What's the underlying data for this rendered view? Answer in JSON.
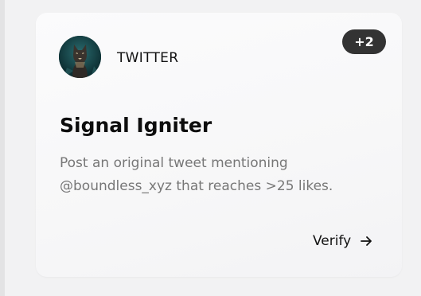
{
  "card": {
    "platform": "TWITTER",
    "badge": "+2",
    "title": "Signal Igniter",
    "description_lines": [
      "Post an original tweet mentioning",
      "@boundless_xyz that reaches >25 likes."
    ],
    "verify_label": "Verify",
    "icons": {
      "avatar": "cat-avatar-image",
      "verify": "arrow-right-icon"
    }
  }
}
